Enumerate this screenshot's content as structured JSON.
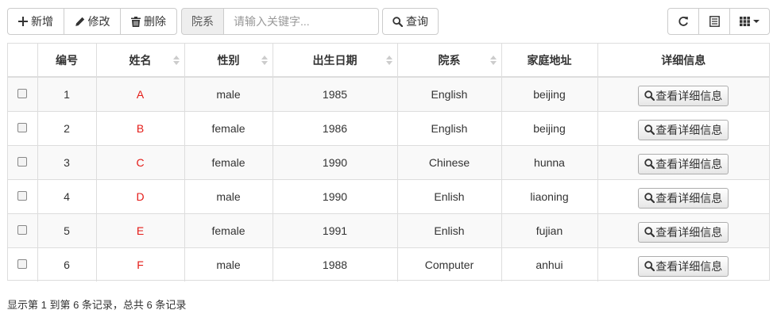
{
  "toolbar": {
    "add_label": "新增",
    "edit_label": "修改",
    "delete_label": "删除",
    "dept_addon": "院系",
    "keyword_placeholder": "请输入关键字...",
    "query_label": "查询"
  },
  "table": {
    "headers": [
      "编号",
      "姓名",
      "性别",
      "出生日期",
      "院系",
      "家庭地址",
      "详细信息"
    ],
    "detail_button_label": "查看详细信息",
    "rows": [
      {
        "id": "1",
        "name": "A",
        "gender": "male",
        "birth": "1985",
        "dept": "English",
        "address": "beijing"
      },
      {
        "id": "2",
        "name": "B",
        "gender": "female",
        "birth": "1986",
        "dept": "English",
        "address": "beijing"
      },
      {
        "id": "3",
        "name": "C",
        "gender": "female",
        "birth": "1990",
        "dept": "Chinese",
        "address": "hunna"
      },
      {
        "id": "4",
        "name": "D",
        "gender": "male",
        "birth": "1990",
        "dept": "Enlish",
        "address": "liaoning"
      },
      {
        "id": "5",
        "name": "E",
        "gender": "female",
        "birth": "1991",
        "dept": "Enlish",
        "address": "fujian"
      },
      {
        "id": "6",
        "name": "F",
        "gender": "male",
        "birth": "1988",
        "dept": "Computer",
        "address": "anhui"
      }
    ]
  },
  "pagination": {
    "summary": "显示第 1 到第 6 条记录，总共 6 条记录"
  },
  "colors": {
    "name_text": "#e41b17",
    "border": "#dddddd",
    "stripe": "#f9f9f9"
  },
  "icons": [
    "plus-icon",
    "pencil-icon",
    "trash-icon",
    "search-icon",
    "refresh-icon",
    "list-icon",
    "columns-icon",
    "caret-down-icon"
  ]
}
